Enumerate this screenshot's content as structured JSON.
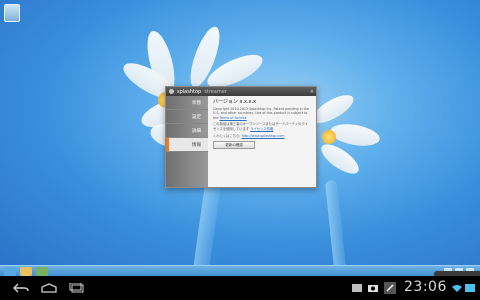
{
  "window": {
    "app_name": "splashtop",
    "app_suffix": "streamer",
    "close_glyph": "×"
  },
  "sidebar": {
    "items": [
      {
        "label": "状態",
        "active": false
      },
      {
        "label": "設定",
        "active": false
      },
      {
        "label": "詳細",
        "active": false
      },
      {
        "label": "情報",
        "active": true
      }
    ]
  },
  "about": {
    "heading": "バージョン x.x.x.x",
    "copyright": "Copyright 2010-2013 Splashtop Inc. Patent pending in the U.S. and other countries. Use of this product is subject to the",
    "terms_link": "Terms of Service",
    "notice": "この製品は第三者のオープンソースまたはサードパーティのライセンスを使用しています",
    "notice_link": "ライセンス情報",
    "website_prefix": "くわしくはこちら:",
    "website_link": "http://www.splashtop.com",
    "button_label": "更新の確認"
  },
  "status_bar": {
    "time": "23:06"
  },
  "colors": {
    "accent": "#f07a1a",
    "desktop": "#3a8fdc",
    "taskbar": "#4a96d2"
  }
}
